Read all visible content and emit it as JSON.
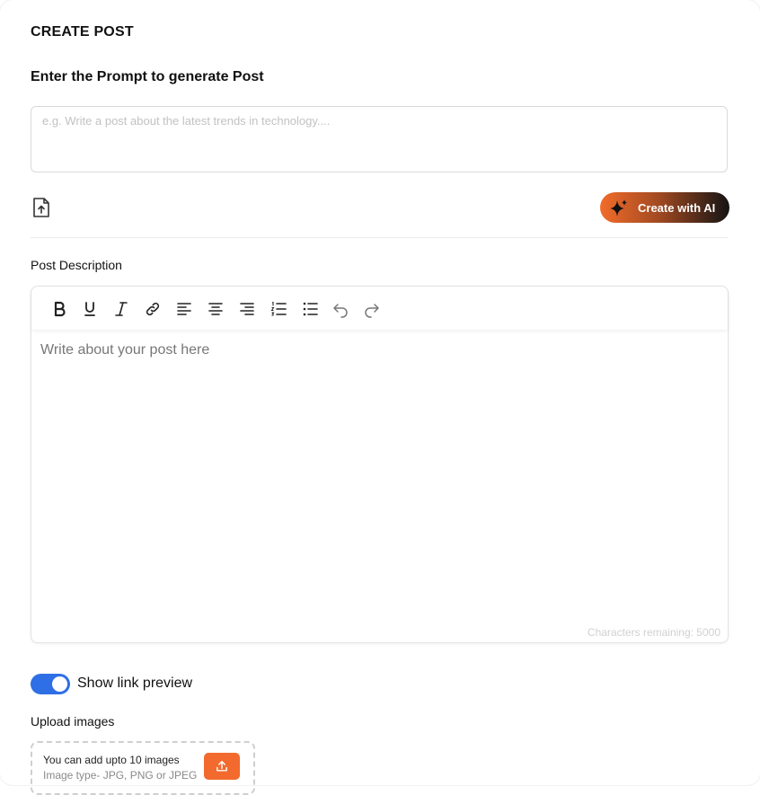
{
  "header": {
    "title": "CREATE POST"
  },
  "prompt": {
    "label": "Enter the Prompt to generate Post",
    "placeholder": "e.g. Write a post about the latest trends in technology....",
    "value": ""
  },
  "ai_button": {
    "label": "Create with AI",
    "icon": "sparkle-icon"
  },
  "description": {
    "label": "Post Description",
    "toolbar": [
      "bold-icon",
      "underline-icon",
      "italic-icon",
      "link-icon",
      "align-left-icon",
      "align-center-icon",
      "align-right-icon",
      "ordered-list-icon",
      "bullet-list-icon",
      "undo-icon",
      "redo-icon"
    ],
    "placeholder": "Write about your post here",
    "chars_remaining": "Characters remaining: 5000"
  },
  "link_preview": {
    "label": "Show link preview",
    "enabled": true
  },
  "images": {
    "label": "Upload images",
    "hint_line1": "You can add upto 10 images",
    "hint_line2": "Image type- JPG, PNG or JPEG"
  },
  "colors": {
    "accent": "#f26a2e",
    "toggle": "#2f6fe5"
  }
}
